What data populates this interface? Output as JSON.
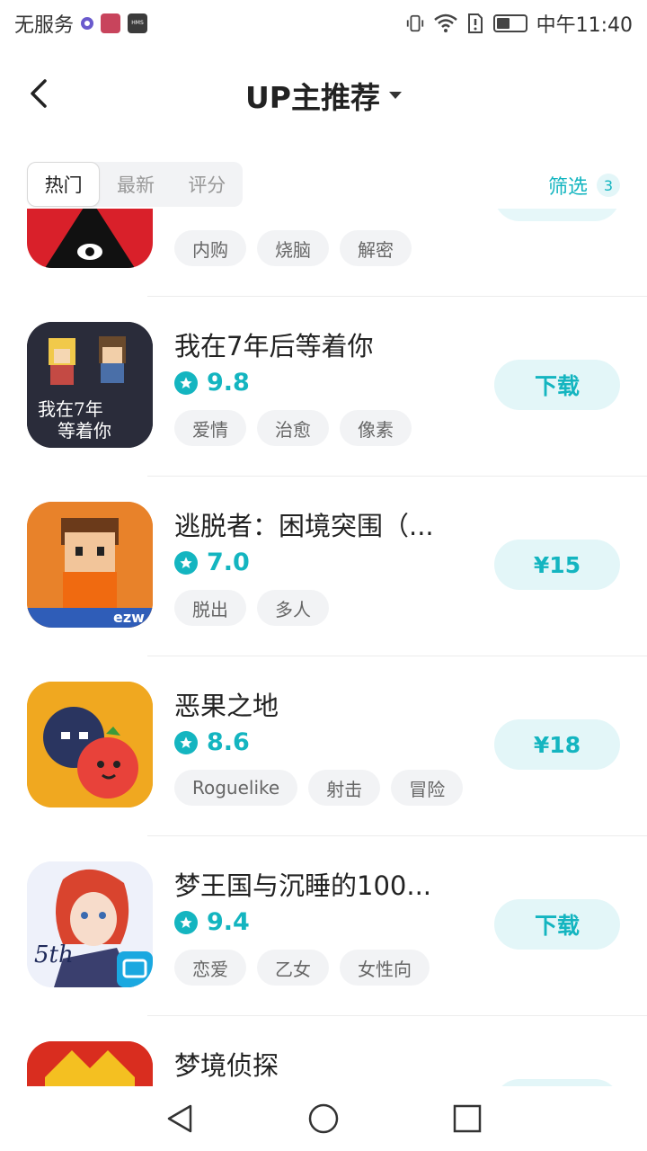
{
  "status_bar": {
    "carrier": "无服务",
    "time": "中午11:40",
    "hms_label": "HMS"
  },
  "header": {
    "title": "UP主推荐"
  },
  "filters": {
    "tabs": [
      {
        "label": "热门",
        "active": true
      },
      {
        "label": "最新",
        "active": false
      },
      {
        "label": "评分",
        "active": false
      }
    ],
    "filter_label": "筛选",
    "filter_count": "3"
  },
  "apps": [
    {
      "name": "",
      "rating": "",
      "tags": [
        "内购",
        "烧脑",
        "解密"
      ],
      "action": ""
    },
    {
      "name": "我在7年后等着你",
      "rating": "9.8",
      "tags": [
        "爱情",
        "治愈",
        "像素"
      ],
      "action": "下载",
      "icon_text": "我在7年后等着你"
    },
    {
      "name": "逃脱者：困境突围（...",
      "rating": "7.0",
      "tags": [
        "脱出",
        "多人"
      ],
      "action": "¥15",
      "icon_text": "ezw"
    },
    {
      "name": "恶果之地",
      "rating": "8.6",
      "tags": [
        "Roguelike",
        "射击",
        "冒险"
      ],
      "action": "¥18"
    },
    {
      "name": "梦王国与沉睡的100...",
      "rating": "9.4",
      "tags": [
        "恋爱",
        "乙女",
        "女性向"
      ],
      "action": "下载",
      "icon_text": "5th"
    },
    {
      "name": "梦境侦探",
      "rating": "",
      "tags": [],
      "action": ""
    }
  ],
  "colors": {
    "accent": "#14b5c0",
    "accent_bg": "#e3f6f8",
    "tag_bg": "#f2f3f5"
  }
}
